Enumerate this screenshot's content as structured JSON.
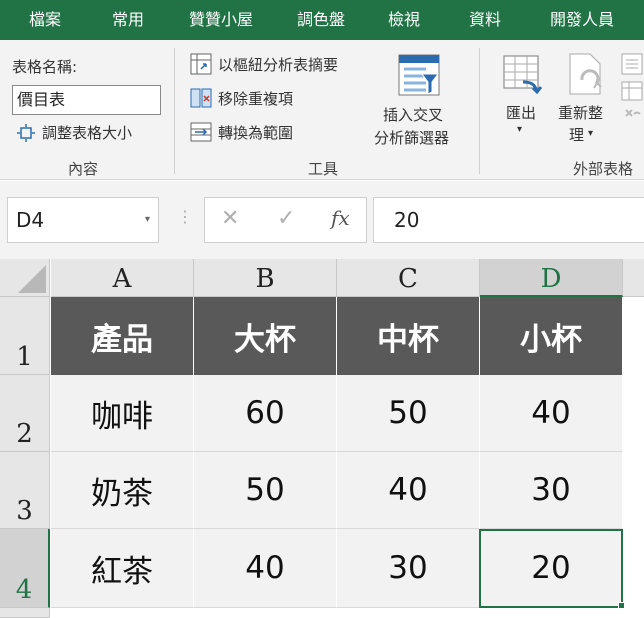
{
  "tabs": [
    "檔案",
    "常用",
    "贊贊小屋",
    "調色盤",
    "檢視",
    "資料",
    "開發人員"
  ],
  "ribbon": {
    "properties": {
      "name_label": "表格名稱:",
      "name_value": "價目表",
      "resize_label": "調整表格大小",
      "group_label": "內容"
    },
    "tools": {
      "pivot_label": "以樞紐分析表摘要",
      "dedupe_label": "移除重複項",
      "convert_label": "轉換為範圍",
      "slicer_line1": "插入交叉",
      "slicer_line2": "分析篩選器",
      "group_label": "工具"
    },
    "external": {
      "export_label": "匯出",
      "refresh_line1": "重新整",
      "refresh_line2": "理",
      "group_label": "外部表格"
    }
  },
  "formula_bar": {
    "cell_ref": "D4",
    "cancel_symbol": "✕",
    "enter_symbol": "✓",
    "fx_symbol": "fx",
    "value": "20"
  },
  "sheet": {
    "columns": [
      "A",
      "B",
      "C",
      "D"
    ],
    "rows": [
      "1",
      "2",
      "3",
      "4"
    ],
    "header": [
      "產品",
      "大杯",
      "中杯",
      "小杯"
    ],
    "data": [
      [
        "咖啡",
        "60",
        "50",
        "40"
      ],
      [
        "奶茶",
        "50",
        "40",
        "30"
      ],
      [
        "紅茶",
        "40",
        "30",
        "20"
      ]
    ],
    "selected_cell": "D4"
  },
  "colors": {
    "ribbon_green": "#217346",
    "table_header": "#595959",
    "table_body": "#f2f2f2"
  }
}
